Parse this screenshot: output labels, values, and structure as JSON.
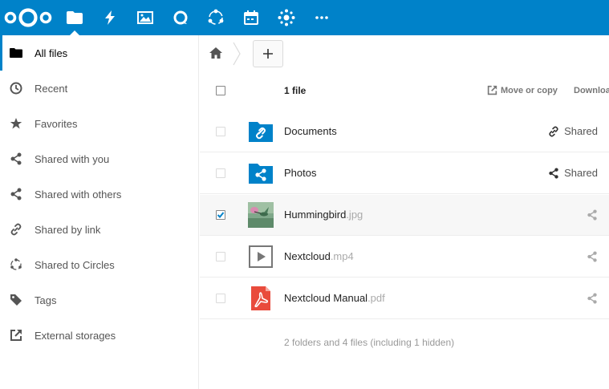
{
  "header": {
    "apps": [
      "files-icon",
      "activity-icon",
      "gallery-icon",
      "talk-icon",
      "circles-icon",
      "calendar-icon",
      "contacts-icon",
      "more-apps-icon"
    ]
  },
  "sidebar": {
    "items": [
      {
        "label": "All files",
        "icon": "folder-icon",
        "active": true
      },
      {
        "label": "Recent",
        "icon": "clock-icon"
      },
      {
        "label": "Favorites",
        "icon": "star-icon"
      },
      {
        "label": "Shared with you",
        "icon": "share-icon"
      },
      {
        "label": "Shared with others",
        "icon": "share-icon"
      },
      {
        "label": "Shared by link",
        "icon": "link-icon"
      },
      {
        "label": "Shared to Circles",
        "icon": "circles-icon"
      },
      {
        "label": "Tags",
        "icon": "tag-icon"
      },
      {
        "label": "External storages",
        "icon": "external-icon"
      }
    ]
  },
  "list": {
    "count_label": "1 file",
    "move_copy_label": "Move or copy",
    "download_label": "Download",
    "files": [
      {
        "name": "Documents",
        "ext": "",
        "type": "folder-link",
        "share": "Shared",
        "selected": false
      },
      {
        "name": "Photos",
        "ext": "",
        "type": "folder-shared",
        "share": "Shared",
        "selected": false
      },
      {
        "name": "Hummingbird",
        "ext": ".jpg",
        "type": "image",
        "share": "",
        "selected": true
      },
      {
        "name": "Nextcloud",
        "ext": ".mp4",
        "type": "video",
        "share": "",
        "selected": false
      },
      {
        "name": "Nextcloud Manual",
        "ext": ".pdf",
        "type": "pdf",
        "share": "",
        "selected": false
      }
    ],
    "summary": "2 folders and 4 files (including 1 hidden)"
  },
  "colors": {
    "brand": "#0082c9",
    "pdf": "#e94b3c"
  }
}
